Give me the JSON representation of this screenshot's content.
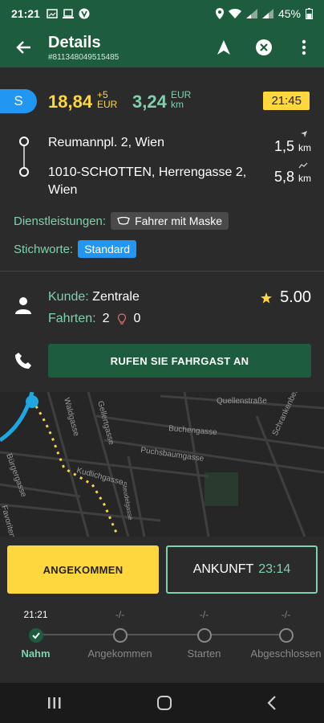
{
  "status": {
    "time": "21:21",
    "battery": "45%"
  },
  "header": {
    "title": "Details",
    "subtitle": "#811348049515485"
  },
  "fare": {
    "badge": "S",
    "price": "18,84",
    "extra": "+5",
    "currency": "EUR",
    "per_km": "3,24",
    "per_km_unit_top": "EUR",
    "per_km_unit_bottom": "km",
    "time": "21:45"
  },
  "route": {
    "pickup": {
      "address": "Reumannpl. 2, Wien",
      "distance": "1,5",
      "unit": "km"
    },
    "dropoff": {
      "address": "1010-SCHOTTEN, Herrengasse 2, Wien",
      "distance": "5,8",
      "unit": "km"
    }
  },
  "services": {
    "label": "Dienstleistungen:",
    "value": "Fahrer mit Maske"
  },
  "keywords": {
    "label": "Stichworte:",
    "value": "Standard"
  },
  "customer": {
    "label": "Kunde:",
    "name": "Zentrale",
    "rides_label": "Fahrten:",
    "rides": "2",
    "other_count": "0",
    "rating": "5.00"
  },
  "call_button": "RUFEN SIE FAHRGAST AN",
  "map": {
    "streets": [
      "Quellenstraße",
      "Buchengasse",
      "Puchsbaumgasse",
      "Waldgasse",
      "Gellertgasse",
      "Kudlichgasse",
      "Bürgergasse",
      "Favoriten",
      "Schrankenberggasse",
      "Steudelgasse"
    ]
  },
  "actions": {
    "arrived": "ANGEKOMMEN",
    "arrival_label": "ANKUNFT",
    "arrival_time": "23:14"
  },
  "progress": [
    {
      "time": "21:21",
      "label": "Nahm",
      "done": true
    },
    {
      "time": "-/-",
      "label": "Angekommen",
      "done": false
    },
    {
      "time": "-/-",
      "label": "Starten",
      "done": false
    },
    {
      "time": "-/-",
      "label": "Abgeschlossen",
      "done": false
    }
  ],
  "colors": {
    "primary": "#1d5d3e",
    "accent": "#7fd1ad",
    "yellow": "#fdd73d",
    "blue": "#2196f3",
    "background": "#2b2b2b"
  }
}
